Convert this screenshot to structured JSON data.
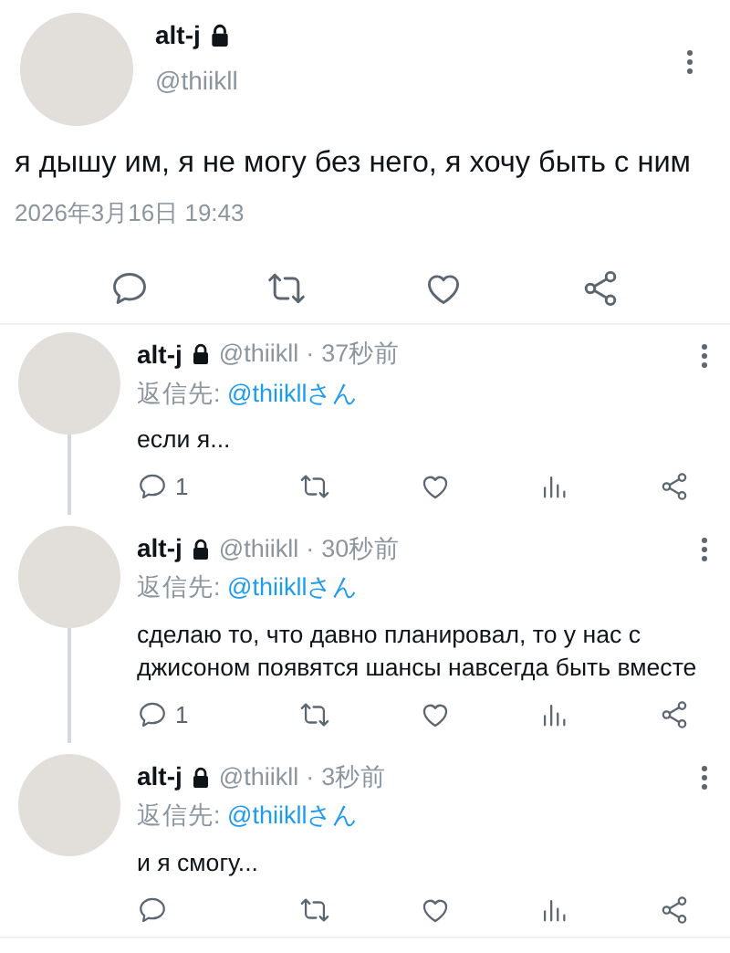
{
  "tweet": {
    "name": "alt-j",
    "locked": true,
    "handle": "@thiikll",
    "text": "я дышу им, я не могу без него, я хочу быть с ним",
    "timestamp": "2026年3月16日 19:43"
  },
  "replies": [
    {
      "name": "alt-j",
      "locked": true,
      "handle": "@thiikll",
      "separator": "·",
      "time": "37秒前",
      "reply_to_label": "返信先:",
      "reply_to": "@thiikllさん",
      "text": "если я...",
      "reply_count": "1",
      "thread_line": true
    },
    {
      "name": "alt-j",
      "locked": true,
      "handle": "@thiikll",
      "separator": "·",
      "time": "30秒前",
      "reply_to_label": "返信先:",
      "reply_to": "@thiikllさん",
      "text": "сделаю то, что давно планировал, то у нас с джисоном появятся шансы навсегда быть вместе",
      "reply_count": "1",
      "thread_line": true
    },
    {
      "name": "alt-j",
      "locked": true,
      "handle": "@thiikll",
      "separator": "·",
      "time": "3秒前",
      "reply_to_label": "返信先:",
      "reply_to": "@thiikllさん",
      "text": "и я смогу...",
      "thread_line": false
    }
  ]
}
